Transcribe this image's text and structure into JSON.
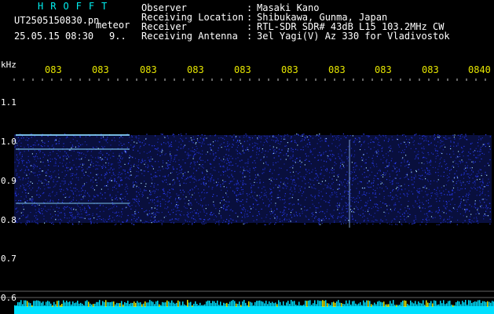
{
  "header": {
    "brand": "HROFFT",
    "filename": "UT2505150830.pn",
    "mode": "meteor",
    "datetime": "25.05.15 08:30",
    "count": "9..",
    "info": [
      {
        "label": "Observer",
        "value": "Masaki Kano"
      },
      {
        "label": "Receiving Location",
        "value": "Shibukawa, Gunma, Japan"
      },
      {
        "label": "Receiver",
        "value": "RTL-SDR SDR# 43dB L15 103.2MHz CW"
      },
      {
        "label": "Receiving Antenna",
        "value": "3el Yagi(V) Az 330 for Vladivostok"
      }
    ]
  },
  "axis": {
    "unit": "kHz",
    "time_labels": [
      "083",
      "083",
      "083",
      "083",
      "083",
      "083",
      "083",
      "083",
      "083",
      "0840"
    ],
    "freq_labels": [
      "1.1",
      "1.0",
      "0.9",
      "0.8",
      "0.7",
      "0.6"
    ]
  },
  "colors": {
    "background": "#000000",
    "text_cyan": "#00f0f0",
    "text_white": "#ffffff",
    "text_yellow": "#e6e600",
    "noise": "#2a3cf0",
    "signal": "#8ad8ff",
    "baseline": "#00e0ff"
  }
}
